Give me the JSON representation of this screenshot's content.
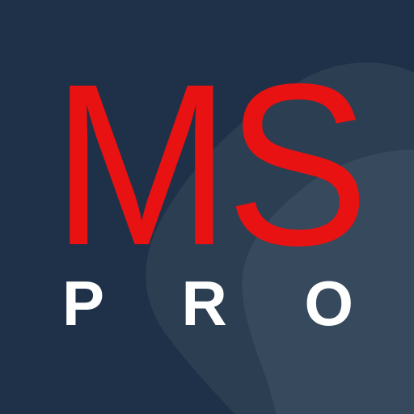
{
  "logo": {
    "primary_text": "MS",
    "secondary_letters": [
      "P",
      "R",
      "O"
    ]
  },
  "colors": {
    "background": "#1e3148",
    "shape_mid": "#2c3e52",
    "shape_light": "#36495d",
    "primary_text": "#e81212",
    "secondary_text": "#ffffff"
  }
}
